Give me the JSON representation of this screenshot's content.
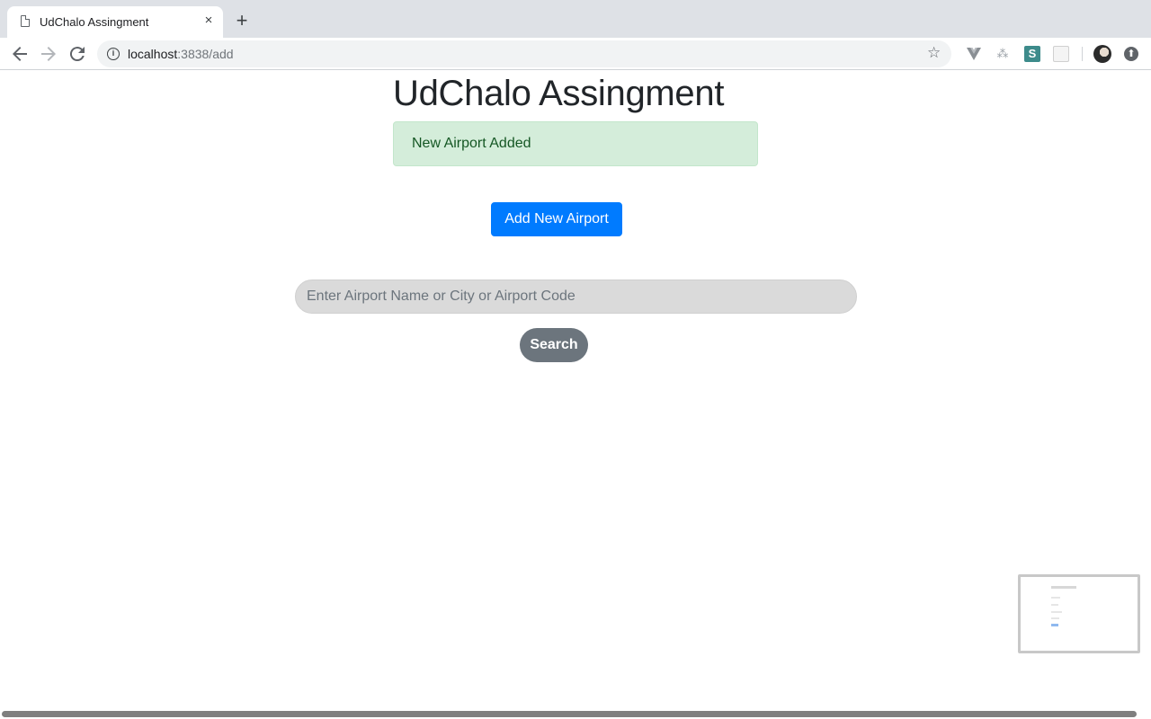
{
  "browser": {
    "tab_title": "UdChalo Assingment",
    "tab_close": "×",
    "new_tab": "+",
    "url_host": "localhost",
    "url_path": ":3838/add",
    "star_glyph": "☆",
    "info_glyph": "i",
    "extensions": {
      "s_label": "S",
      "tree_glyph": "⁂",
      "update_glyph": "⬆"
    }
  },
  "page": {
    "title": "UdChalo Assingment",
    "alert_message": "New Airport Added",
    "add_button_label": "Add New Airport",
    "search": {
      "placeholder": "Enter Airport Name or City or Airport Code",
      "value": "",
      "button_label": "Search"
    }
  },
  "colors": {
    "primary": "#007bff",
    "success_bg": "#d4edda",
    "success_text": "#155724",
    "secondary": "#6c757d",
    "input_bg": "#dadada"
  }
}
